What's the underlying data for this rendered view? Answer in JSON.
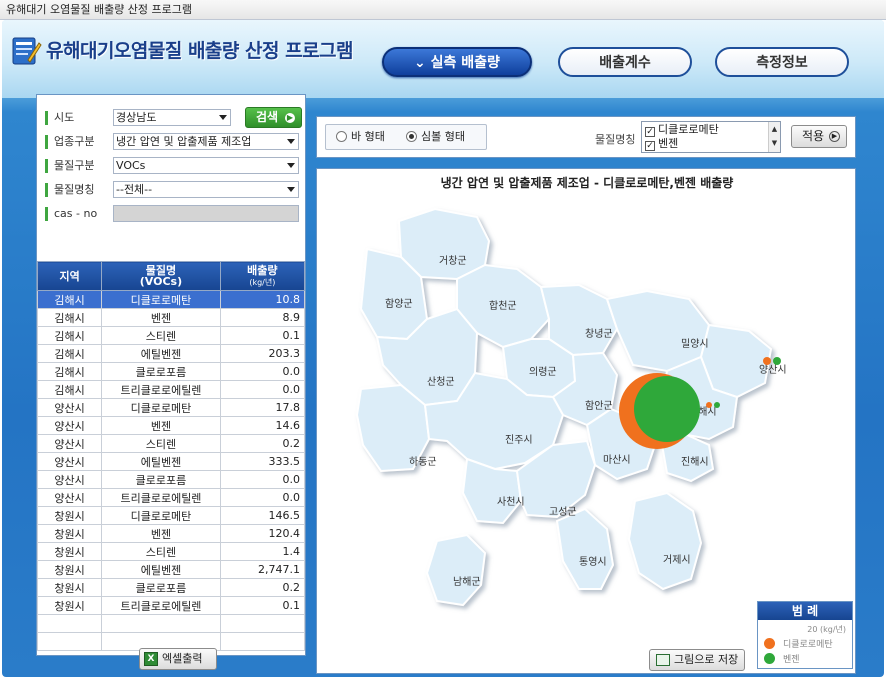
{
  "window": {
    "title": "유해대기 오염물질 배출량 산정 프로그램"
  },
  "app": {
    "title": "유해대기오염물질 배출량 산정 프로그램"
  },
  "nav": {
    "emission_label": "⌄ 실측 배출량",
    "factor_label": "배출계수",
    "measure_label": "측정정보"
  },
  "filters": {
    "sido_label": "시도",
    "sido_value": "경상남도",
    "search_label": "검색",
    "industry_label": "업종구분",
    "industry_value": "냉간 압연 및 압출제품 제조업",
    "substance_type_label": "물질구분",
    "substance_type_value": "VOCs",
    "substance_name_label": "물질명칭",
    "substance_name_value": "--전체--",
    "cas_label": "cas - no",
    "cas_value": ""
  },
  "table": {
    "headers": {
      "region": "지역",
      "substance": "물질명",
      "substance_sub": "(VOCs)",
      "emission": "배출량",
      "emission_unit": "(kg/년)"
    },
    "rows": [
      {
        "region": "김해시",
        "substance": "디클로로메탄",
        "value": "10.8"
      },
      {
        "region": "김해시",
        "substance": "벤젠",
        "value": "8.9"
      },
      {
        "region": "김해시",
        "substance": "스티렌",
        "value": "0.1"
      },
      {
        "region": "김해시",
        "substance": "에틸벤젠",
        "value": "203.3"
      },
      {
        "region": "김해시",
        "substance": "클로로포름",
        "value": "0.0"
      },
      {
        "region": "김해시",
        "substance": "트리클로로에틸렌",
        "value": "0.0"
      },
      {
        "region": "양산시",
        "substance": "디클로로메탄",
        "value": "17.8"
      },
      {
        "region": "양산시",
        "substance": "벤젠",
        "value": "14.6"
      },
      {
        "region": "양산시",
        "substance": "스티렌",
        "value": "0.2"
      },
      {
        "region": "양산시",
        "substance": "에틸벤젠",
        "value": "333.5"
      },
      {
        "region": "양산시",
        "substance": "클로로포름",
        "value": "0.0"
      },
      {
        "region": "양산시",
        "substance": "트리클로로에틸렌",
        "value": "0.0"
      },
      {
        "region": "창원시",
        "substance": "디클로로메탄",
        "value": "146.5"
      },
      {
        "region": "창원시",
        "substance": "벤젠",
        "value": "120.4"
      },
      {
        "region": "창원시",
        "substance": "스티렌",
        "value": "1.4"
      },
      {
        "region": "창원시",
        "substance": "에틸벤젠",
        "value": "2,747.1"
      },
      {
        "region": "창원시",
        "substance": "클로로포름",
        "value": "0.2"
      },
      {
        "region": "창원시",
        "substance": "트리클로로에틸렌",
        "value": "0.1"
      }
    ]
  },
  "excel_label": "엑셀출력",
  "options": {
    "bar_label": "바 형태",
    "symbol_label": "심볼 형태",
    "substance_label": "물질명칭",
    "substances": [
      "디클로로메탄",
      "벤젠"
    ],
    "apply_label": "적용"
  },
  "map": {
    "title": "냉간 압연 및 압출제품 제조업 - 디클로로메탄,벤젠 배출량",
    "regions": [
      "거창군",
      "함양군",
      "합천군",
      "창녕군",
      "밀양시",
      "양산시",
      "산청군",
      "의령군",
      "함안군",
      "김해시",
      "하동군",
      "진주시",
      "마산시",
      "진해시",
      "사천시",
      "고성군",
      "통영시",
      "거제시",
      "남해군"
    ],
    "legend_title": "범 례",
    "legend_unit": "20 (kg/년)",
    "legend_items": [
      {
        "name": "디클로로메탄",
        "color": "#f0711e"
      },
      {
        "name": "벤젠",
        "color": "#2fa83a"
      }
    ],
    "save_label": "그림으로 저장"
  }
}
